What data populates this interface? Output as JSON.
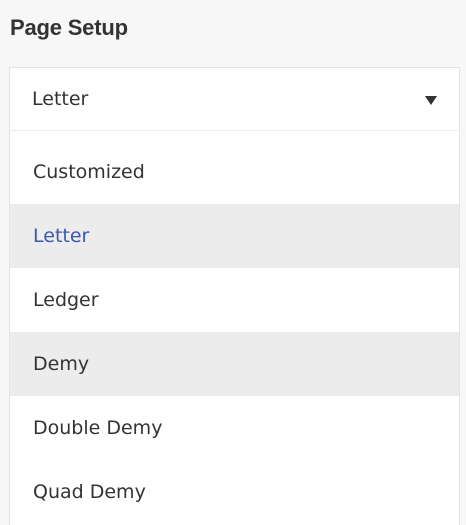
{
  "panel": {
    "title": "Page Setup"
  },
  "page_size_select": {
    "value": "Letter",
    "arrow_icon": "caret-down-icon"
  },
  "options": [
    {
      "label": "Customized",
      "state": "normal"
    },
    {
      "label": "Letter",
      "state": "selected"
    },
    {
      "label": "Ledger",
      "state": "normal"
    },
    {
      "label": "Demy",
      "state": "hover"
    },
    {
      "label": "Double Demy",
      "state": "normal"
    },
    {
      "label": "Quad Demy",
      "state": "normal"
    }
  ],
  "colors": {
    "selected_text": "#3b57b5",
    "highlight_bg": "#ececec",
    "text": "#333333"
  }
}
